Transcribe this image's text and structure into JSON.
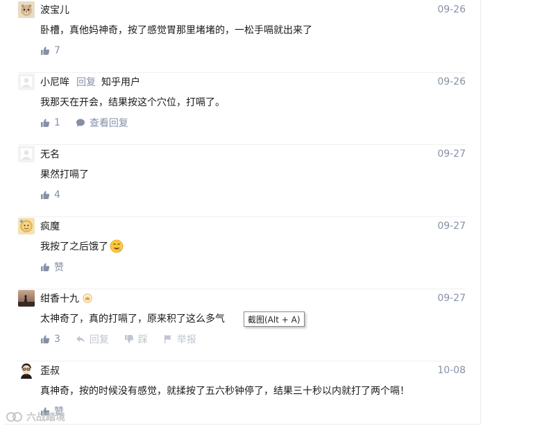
{
  "comments": [
    {
      "author": "波宝儿",
      "date": "09-26",
      "text": "卧槽，真他妈神奇，按了感觉胃那里堵堵的，一松手嗝就出来了",
      "likes": "7",
      "avatar_icon": "dog-avatar-icon"
    },
    {
      "author": "小尼哞",
      "reply_tag": "回复",
      "reply_to": "知乎用户",
      "date": "09-26",
      "text": "我那天在开会，结果按这个穴位，打嗝了。",
      "likes": "1",
      "view_replies": "查看回复",
      "avatar_icon": "default-avatar-icon"
    },
    {
      "author": "无名",
      "date": "09-27",
      "text": "果然打嗝了",
      "likes": "4",
      "avatar_icon": "default-avatar-icon"
    },
    {
      "author": "疯魔",
      "date": "09-27",
      "text": "我按了之后饿了",
      "likes": "赞",
      "avatar_icon": "cartoon-avatar-icon",
      "emoji_icon": "drooling-emoji-icon"
    },
    {
      "author": "绀香十九",
      "date": "09-27",
      "text": "太神奇了，真的打嗝了，原来积了这么多气",
      "likes": "3",
      "reply": "回复",
      "dislike": "踩",
      "report": "举报",
      "avatar_icon": "sunset-avatar-icon",
      "badge_icon": "crown-badge-icon"
    },
    {
      "author": "歪叔",
      "date": "10-08",
      "text": "真神奇，按的时候没有感觉，就揉按了五六秒钟停了，结果三十秒以内就打了两个嗝！",
      "likes": "赞",
      "avatar_icon": "cartoon-man-avatar-icon"
    }
  ],
  "tooltip": "截图(Alt + A)",
  "watermark": "六战踏境",
  "colors": {
    "text": "#1a1a1a",
    "meta": "#8590a6",
    "faint": "#bfc5d0",
    "divider": "#f0f0f0"
  }
}
